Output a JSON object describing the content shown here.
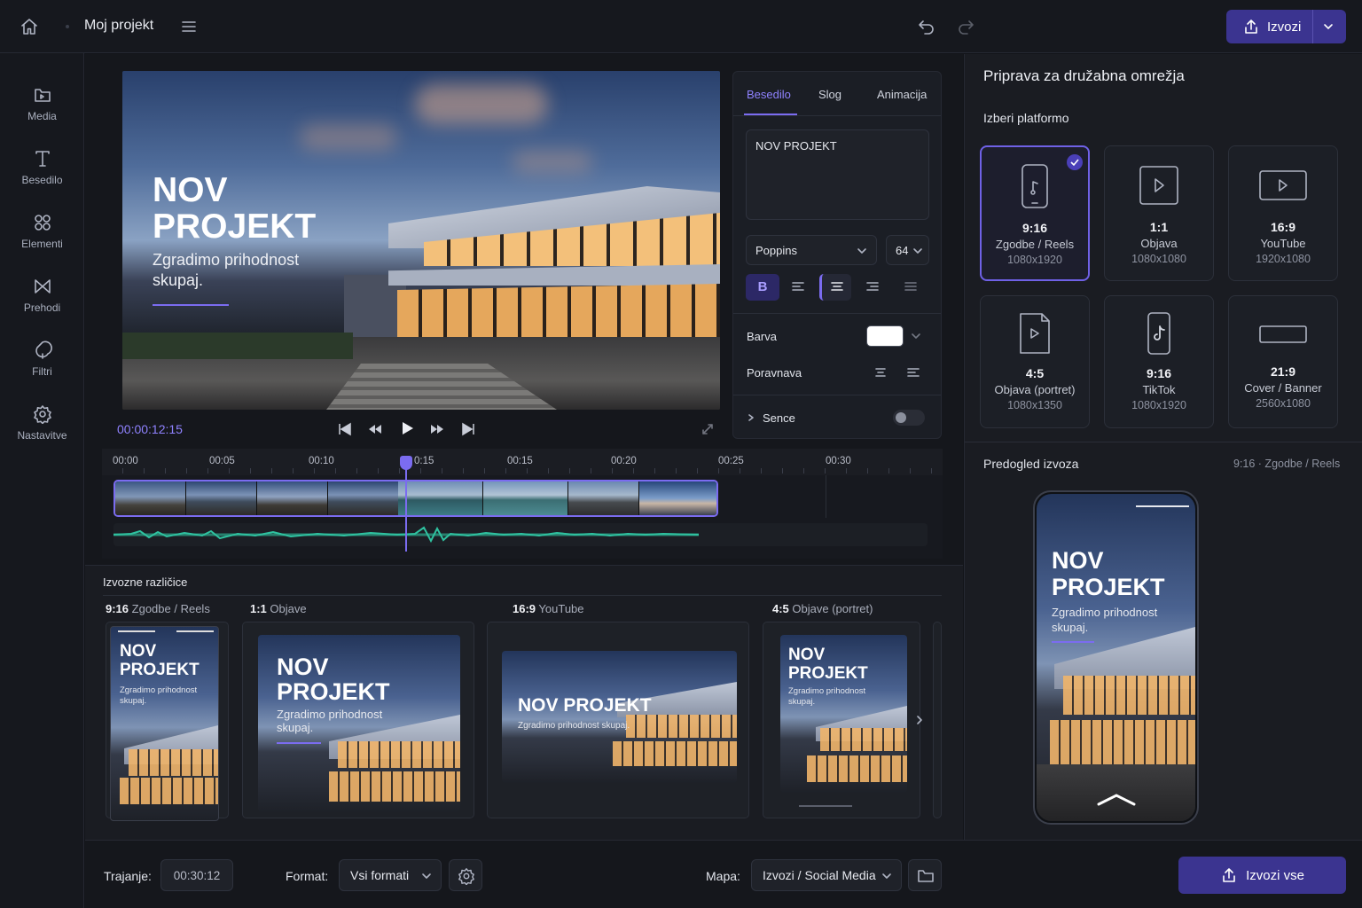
{
  "header": {
    "project_name": "Moj projekt",
    "export_label": "Izvozi"
  },
  "sidebar": {
    "items": [
      {
        "label": "Media",
        "icon": "folder-icon"
      },
      {
        "label": "Besedilo",
        "icon": "text-icon"
      },
      {
        "label": "Elementi",
        "icon": "elements-icon"
      },
      {
        "label": "Prehodi",
        "icon": "transitions-icon"
      },
      {
        "label": "Filtri",
        "icon": "filters-icon"
      },
      {
        "label": "Nastavitve",
        "icon": "gear-icon"
      }
    ]
  },
  "preview": {
    "title_line1": "NOV",
    "title_line2": "PROJEKT",
    "subtitle_line1": "Zgradimo prihodnost",
    "subtitle_line2": "skupaj.",
    "timecode": "00:00:12:15"
  },
  "timeline": {
    "ticks": [
      "00:00",
      "00:05",
      "00:10",
      "0:15",
      "00:15",
      "00:20",
      "00:25",
      "00:30"
    ],
    "playhead_fraction": 0.47
  },
  "text_panel": {
    "tabs": [
      "Besedilo",
      "Slog",
      "Animacija"
    ],
    "active_tab": "Besedilo",
    "text_value": "NOV PROJEKT",
    "font": "Poppins",
    "font_size": "64",
    "bold_label": "B",
    "color_label": "Barva",
    "color_value": "#ffffff",
    "align_label": "Poravnava",
    "shadow_label": "Sence",
    "shadow_enabled": false
  },
  "variants": {
    "title": "Izvozne različice",
    "items": [
      {
        "ratio": "9:16",
        "name": "Zgodbe / Reels",
        "title": "NOV PROJEKT",
        "subtitle": "Zgradimo prihodnost skupaj."
      },
      {
        "ratio": "1:1",
        "name": "Objave",
        "title": "NOV PROJEKT",
        "subtitle": "Zgradimo prihodnost skupaj."
      },
      {
        "ratio": "16:9",
        "name": "YouTube",
        "title": "NOV PROJEKT",
        "subtitle": "Zgradimo prihodnost skupaj."
      },
      {
        "ratio": "4:5",
        "name": "Objave (portret)",
        "title": "NOV PROJEKT",
        "subtitle": "Zgradimo prihodnost skupaj."
      }
    ]
  },
  "social_panel": {
    "title": "Priprava za družabna omrežja",
    "platform_label": "Izberi platformo",
    "platforms": [
      {
        "ratio": "9:16",
        "name": "Zgodbe / Reels",
        "size": "1080x1920",
        "selected": true,
        "icon": "phone-music-icon"
      },
      {
        "ratio": "1:1",
        "name": "Objava",
        "size": "1080x1080",
        "selected": false,
        "icon": "square-play-icon"
      },
      {
        "ratio": "16:9",
        "name": "YouTube",
        "size": "1920x1080",
        "selected": false,
        "icon": "youtube-play-icon"
      },
      {
        "ratio": "4:5",
        "name": "Objava (portret)",
        "size": "1080x1350",
        "selected": false,
        "icon": "document-play-icon"
      },
      {
        "ratio": "9:16",
        "name": "TikTok",
        "size": "1080x1920",
        "selected": false,
        "icon": "tiktok-icon"
      },
      {
        "ratio": "21:9",
        "name": "Cover / Banner",
        "size": "2560x1080",
        "selected": false,
        "icon": "banner-icon"
      }
    ],
    "preview_label": "Predogled izvoza",
    "preview_format": "9:16 · Zgodbe / Reels",
    "phone_title_line1": "NOV",
    "phone_title_line2": "PROJEKT",
    "phone_subtitle_line1": "Zgradimo prihodnost",
    "phone_subtitle_line2": "skupaj."
  },
  "footer": {
    "duration_label": "Trajanje:",
    "duration_value": "00:30:12",
    "format_label": "Format:",
    "format_value": "Vsi formati",
    "folder_label": "Mapa:",
    "folder_value": "Izvozi / Social Media",
    "export_all_label": "Izvozi vse"
  },
  "colors": {
    "accent": "#7b6cf0",
    "accent_button": "#3b3490",
    "waveform": "#2fc2a0",
    "timecode": "#8f82ff"
  }
}
